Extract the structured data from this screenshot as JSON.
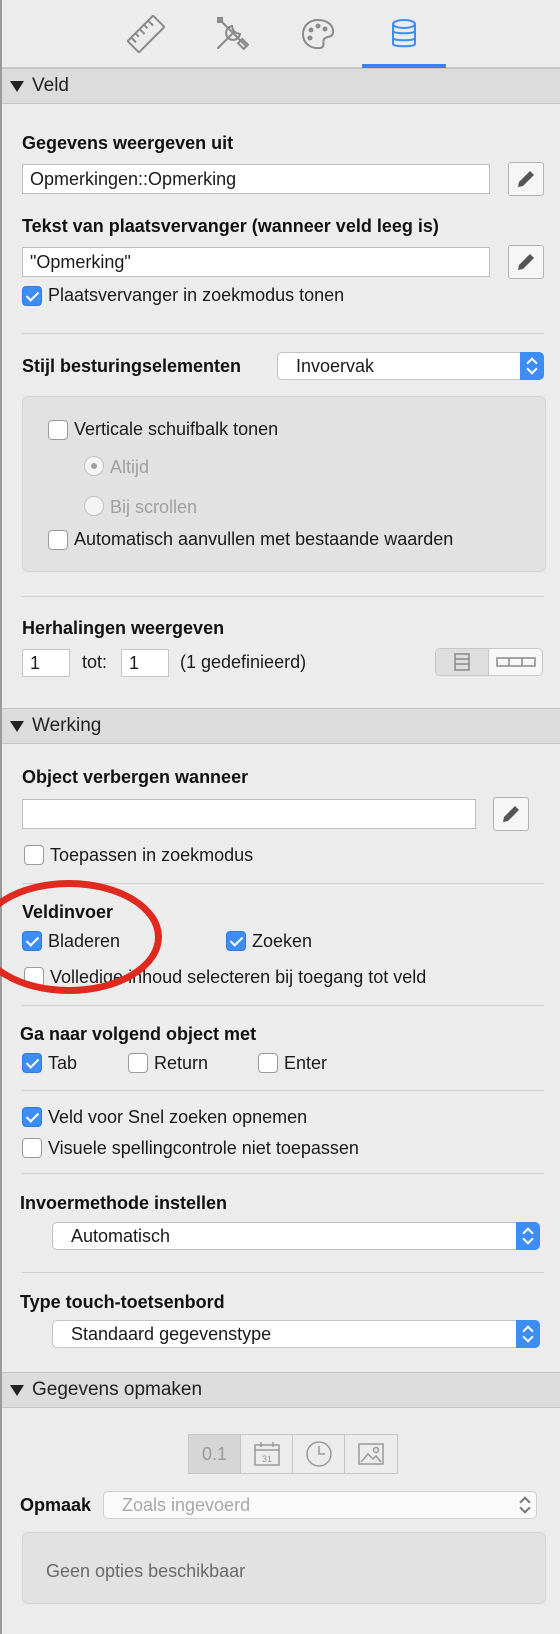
{
  "toolbar": {
    "tabs": [
      {
        "icon": "ruler-icon"
      },
      {
        "icon": "tools-icon"
      },
      {
        "icon": "palette-icon"
      },
      {
        "icon": "database-icon",
        "active": true
      }
    ]
  },
  "section_veld": {
    "header": "Veld",
    "data_source_label": "Gegevens weergeven uit",
    "data_source_value": "Opmerkingen::Opmerking",
    "placeholder_label": "Tekst van plaatsvervanger (wanneer veld leeg is)",
    "placeholder_value": "\"Opmerking\"",
    "show_placeholder_find": {
      "label": "Plaatsvervanger in zoekmodus tonen",
      "checked": true
    },
    "control_style_label": "Stijl besturingselementen",
    "control_style_value": "Invoervak",
    "vertical_scrollbar": {
      "label": "Verticale schuifbalk tonen",
      "checked": false
    },
    "radio_always": {
      "label": "Altijd",
      "selected": true
    },
    "radio_on_scroll": {
      "label": "Bij scrollen",
      "selected": false
    },
    "autocomplete": {
      "label": "Automatisch aanvullen met bestaande waarden",
      "checked": false
    },
    "repetitions_label": "Herhalingen weergeven",
    "repetitions_from": "1",
    "repetitions_to_label": "tot:",
    "repetitions_to": "1",
    "repetitions_defined": "(1 gedefinieerd)"
  },
  "section_werking": {
    "header": "Werking",
    "hide_label": "Object verbergen wanneer",
    "hide_value": "",
    "apply_in_find": {
      "label": "Toepassen in zoekmodus",
      "checked": false
    },
    "field_entry_label": "Veldinvoer",
    "browse": {
      "label": "Bladeren",
      "checked": true
    },
    "find": {
      "label": "Zoeken",
      "checked": true
    },
    "select_entire": {
      "label": "Volledige inhoud selecteren bij toegang tot veld",
      "checked": false
    },
    "goto_next_label": "Ga naar volgend object met",
    "tab": {
      "label": "Tab",
      "checked": true
    },
    "return": {
      "label": "Return",
      "checked": false
    },
    "enter": {
      "label": "Enter",
      "checked": false
    },
    "quick_find": {
      "label": "Veld voor Snel zoeken opnemen",
      "checked": true
    },
    "no_spellcheck": {
      "label": "Visuele spellingcontrole niet toepassen",
      "checked": false
    },
    "input_method_label": "Invoermethode instellen",
    "input_method_value": "Automatisch",
    "keyboard_label": "Type touch-toetsenbord",
    "keyboard_value": "Standaard gegevenstype"
  },
  "section_format": {
    "header": "Gegevens opmaken",
    "number_tab": "0.1",
    "calendar_day": "31",
    "format_label": "Opmaak",
    "format_value": "Zoals ingevoerd",
    "no_options": "Geen opties beschikbaar"
  },
  "colors": {
    "accent": "#3d8df5",
    "annotation": "#e12a1f"
  }
}
